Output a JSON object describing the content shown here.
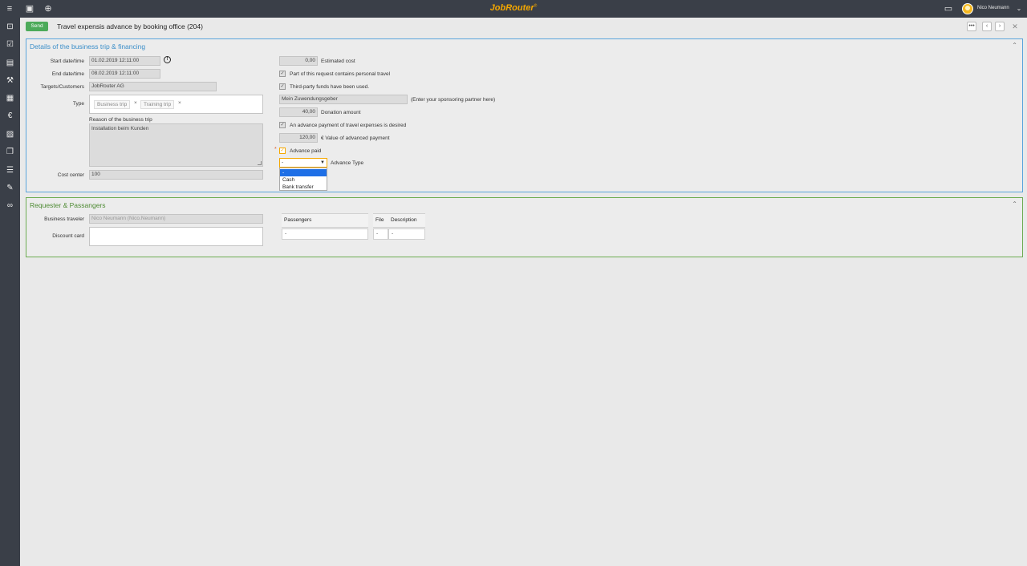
{
  "topbar": {
    "brand": "JobRouter",
    "brand_mark": "®",
    "user_name": "Nico Neumann"
  },
  "header": {
    "send_label": "Send",
    "title": "Travel expensis advance by booking office (204)",
    "more_label": "•••",
    "prev_label": "‹",
    "next_label": "›",
    "close_label": "✕"
  },
  "section1": {
    "title": "Details of the business trip & financing",
    "start_label": "Start date/time",
    "start_value": "01.02.2019 12:11:00",
    "end_label": "End date/time",
    "end_value": "08.02.2019 12:11:00",
    "targets_label": "Targets/Customers",
    "targets_value": "JobRouter AG",
    "type_label": "Type",
    "type_tags": [
      "Business trip",
      "Training trip"
    ],
    "reason_label": "Reason of the business trip",
    "reason_value": "Installation beim Kunden",
    "cost_center_label": "Cost center",
    "cost_center_value": "100",
    "estimated_cost_value": "0,00",
    "estimated_cost_label": "Estimated cost",
    "personal_travel_label": "Part of this request contains personal travel",
    "third_party_label": "Third-party funds have been used.",
    "sponsor_value": "Mein Zuwendungsgeber",
    "sponsor_hint": "(Enter your sponsoring partner here)",
    "donation_value": "40,00",
    "donation_label": "Donation amount",
    "advance_desired_label": "An advance payment of travel expenses is desired",
    "advance_value": "120,00",
    "advance_value_label": "€ Value of advanced payment",
    "advance_paid_label": "Advance paid",
    "advance_type_label": "Advance Type",
    "advance_type_selected": "-",
    "advance_type_options": [
      "-",
      "Cash",
      "Bank transfer"
    ]
  },
  "section2": {
    "title": "Requester & Passangers",
    "traveler_label": "Business traveler",
    "traveler_value": "Nico Neumann (Nico.Neumann)",
    "discount_label": "Discount card",
    "discount_value": "",
    "table": {
      "headers": [
        "Passengers",
        "File",
        "Description"
      ],
      "row": [
        "-",
        "-",
        "-"
      ]
    }
  },
  "colors": {
    "accent": "#f5a800",
    "section1_border": "#5aa5dc",
    "section2_border": "#6dac52",
    "send_button": "#4caa5a",
    "bar": "#3a3f48"
  }
}
